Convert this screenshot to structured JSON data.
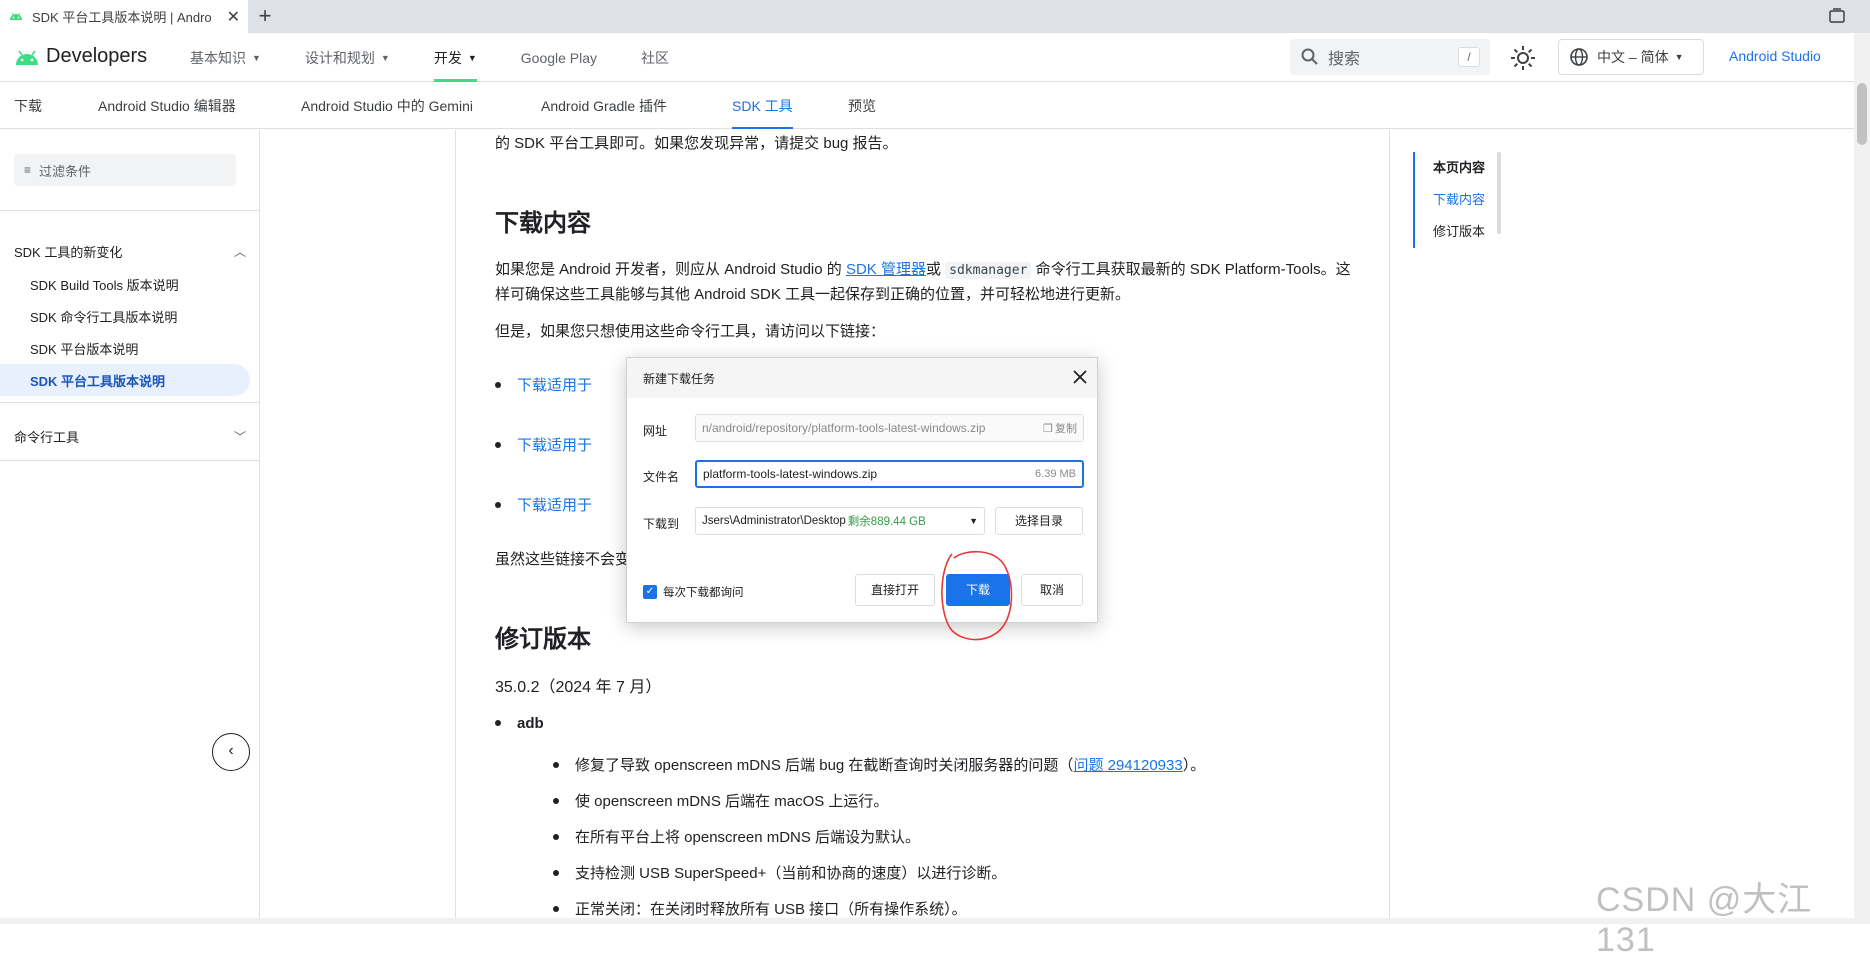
{
  "browser": {
    "tab_title": "SDK 平台工具版本说明 | Andro",
    "new_tab": "+",
    "tab_close": "✕"
  },
  "site": {
    "brand": "Developers",
    "nav": [
      {
        "label": "基本知识",
        "has_menu": true
      },
      {
        "label": "设计和规划",
        "has_menu": true
      },
      {
        "label": "开发",
        "has_menu": true,
        "active": true
      },
      {
        "label": "Google Play",
        "has_menu": false
      },
      {
        "label": "社区",
        "has_menu": false
      }
    ],
    "search_placeholder": "搜索",
    "search_shortcut": "/",
    "language": "中文 – 简体",
    "studio_link": "Android Studio"
  },
  "subnav": [
    "下载",
    "Android Studio 编辑器",
    "Android Studio 中的 Gemini",
    "Android Gradle 插件",
    "SDK 工具",
    "预览"
  ],
  "subnav_active": "SDK 工具",
  "sidebar": {
    "filter_placeholder": "过滤条件",
    "section1": "SDK 工具的新变化",
    "items": [
      "SDK Build Tools 版本说明",
      "SDK 命令行工具版本说明",
      "SDK 平台版本说明",
      "SDK 平台工具版本说明"
    ],
    "active_item": "SDK 平台工具版本说明",
    "section2": "命令行工具"
  },
  "article": {
    "intro_tail": "的 SDK 平台工具即可。如果您发现异常，请提交 bug 报告。",
    "h_download": "下载内容",
    "p1_a": "如果您是 Android 开发者，则应从 Android Studio 的 ",
    "p1_link": "SDK 管理器",
    "p1_b": "或 ",
    "p1_code": "sdkmanager",
    "p1_c": " 命令行工具获取最新的 SDK Platform-Tools。这样可确保这些工具能够与其他 Android SDK 工具一起保存到正确的位置，并可轻松地进行更新。",
    "p2": "但是，如果您只想使用这些命令行工具，请访问以下链接：",
    "dl_links": [
      "下载适用于",
      "下载适用于",
      "下载适用于"
    ],
    "p3": "虽然这些链接不会变",
    "h_revisions": "修订版本",
    "version": "35.0.2（2024 年 7 月）",
    "adb": "adb",
    "fix1_a": "修复了导致 openscreen mDNS 后端 bug 在截断查询时关闭服务器的问题（",
    "fix1_link": "问题 294120933",
    "fix1_b": "）。",
    "fix2": "使 openscreen mDNS 后端在 macOS 上运行。",
    "fix3": "在所有平台上将 openscreen mDNS 后端设为默认。",
    "fix4": "支持检测 USB SuperSpeed+（当前和协商的速度）以进行诊断。",
    "fix5": "正常关闭：在关闭时释放所有 USB 接口（所有操作系统）。"
  },
  "toc": {
    "title": "本页内容",
    "items": [
      "下载内容",
      "修订版本"
    ]
  },
  "dialog": {
    "title": "新建下载任务",
    "url_label": "网址",
    "url_value": "n/android/repository/platform-tools-latest-windows.zip",
    "copy_label": "复制",
    "filename_label": "文件名",
    "filename_value": "platform-tools-latest-windows.zip",
    "file_size": "6.39 MB",
    "saveto_label": "下载到",
    "saveto_path": "Jsers\\Administrator\\Desktop",
    "saveto_free": "剩余889.44 GB",
    "pick_dir": "选择目录",
    "ask_each_time": "每次下载都询问",
    "btn_open": "直接打开",
    "btn_download": "下载",
    "btn_cancel": "取消"
  },
  "watermark": "CSDN @大江131",
  "colors": {
    "accent": "#1a73e8",
    "active_nav_underline": "#3ddc84",
    "free_space": "#2e9e44",
    "annotation": "#e53935"
  }
}
